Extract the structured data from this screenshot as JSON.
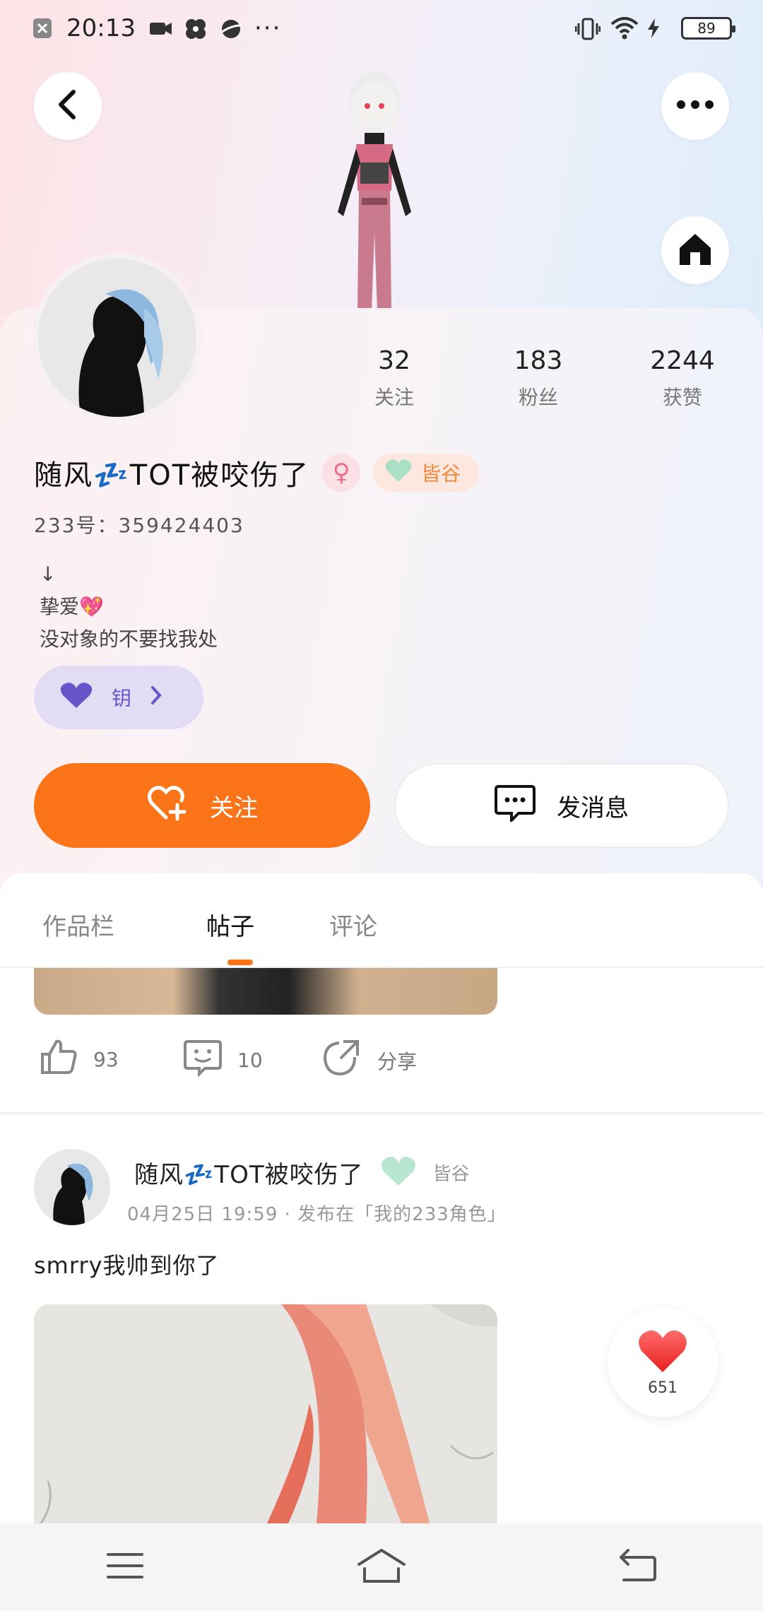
{
  "status_bar": {
    "time": "20:13",
    "more": "···",
    "battery": "89"
  },
  "profile": {
    "stats": [
      {
        "value": "32",
        "label": "关注"
      },
      {
        "value": "183",
        "label": "粉丝"
      },
      {
        "value": "2244",
        "label": "获赞"
      }
    ],
    "name": "随风💤TOT被咬伤了",
    "gender_symbol": "♀",
    "tag_label": "皆谷",
    "uid": "233号：359424403",
    "bio_lines": [
      "↓",
      "挚爱💖",
      "没对象的不要找我处"
    ],
    "vip_label": "钥"
  },
  "actions": {
    "follow_label": "关注",
    "message_label": "发消息"
  },
  "tabs": [
    {
      "label": "作品栏"
    },
    {
      "label": "帖子"
    },
    {
      "label": "评论"
    }
  ],
  "prev_post": {
    "likes": "93",
    "comments": "10",
    "share_label": "分享"
  },
  "post": {
    "author": "随风💤TOT被咬伤了",
    "tag": "皆谷",
    "meta": "04月25日 19:59 · 发布在「我的233角色」",
    "text": "smrry我帅到你了"
  },
  "float_like": {
    "count": "651"
  },
  "colors": {
    "accent": "#fb7518",
    "vip": "#6a55c8",
    "tag": "#f08a3a"
  }
}
